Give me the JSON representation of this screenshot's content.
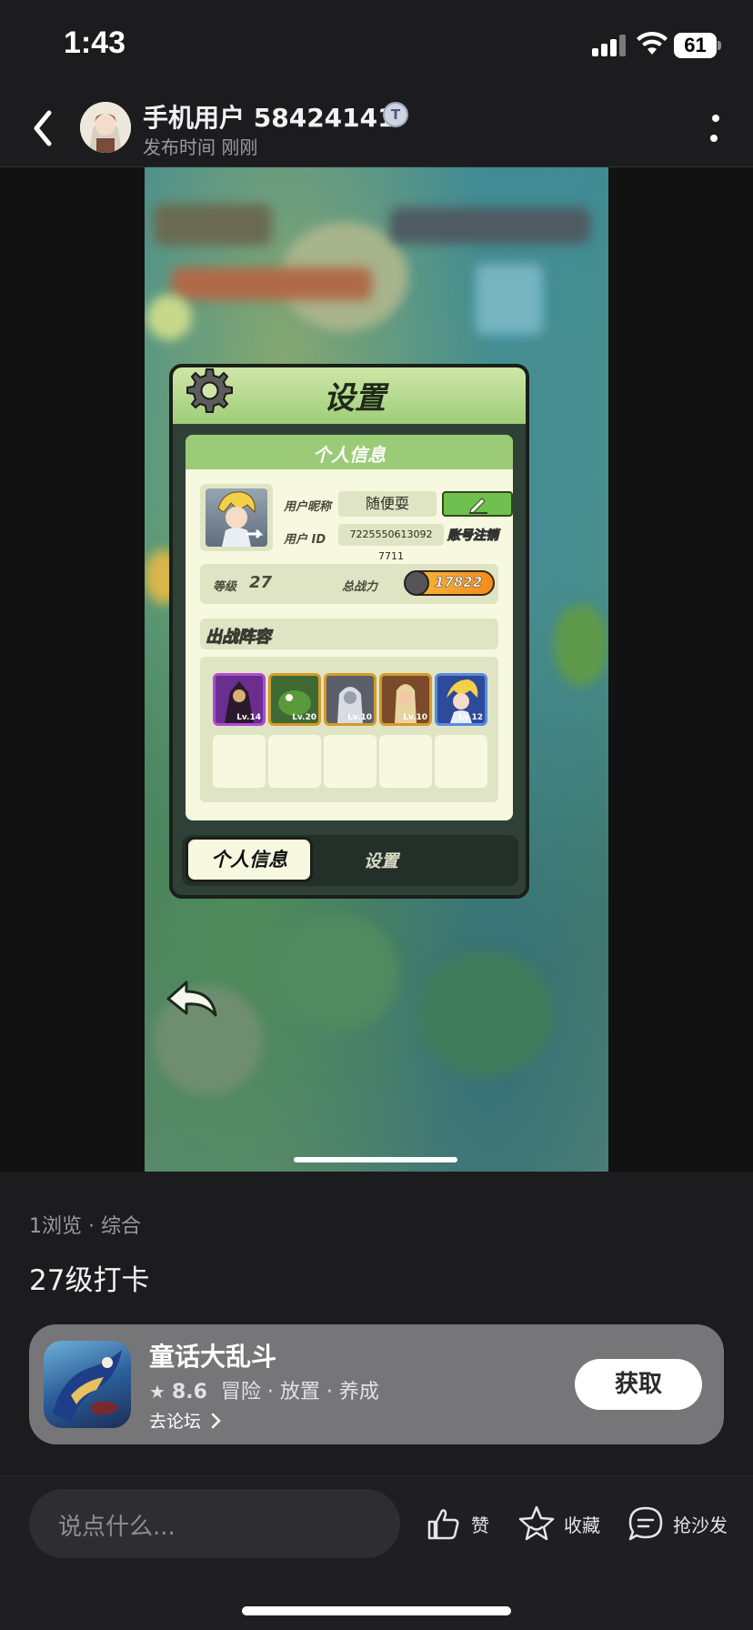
{
  "status_bar": {
    "time": "1:43",
    "battery": "61"
  },
  "header": {
    "user_name": "手机用户 58424141",
    "post_time": "发布时间 刚刚",
    "verified_badge": "T"
  },
  "media": {
    "panel_title": "设置",
    "info_header": "个人信息",
    "nickname_label": "用户昵称",
    "nickname_value": "随便耍",
    "userid_label": "用户 ID",
    "userid_value": "7225550613092​7711",
    "cancel_label": "账号注销",
    "level_label": "等级",
    "level_value": "27",
    "power_label": "总战力",
    "power_value": "17822",
    "lineup_label": "出战阵容",
    "heroes": [
      {
        "level": "Lv.14",
        "color": "#6a2e8e"
      },
      {
        "level": "Lv.20",
        "color": "#3f6a34"
      },
      {
        "level": "Lv.10",
        "color": "#5a5f6a"
      },
      {
        "level": "Lv.10",
        "color": "#7a4a2a"
      },
      {
        "level": "Lv.12",
        "color": "#2e4a9a"
      }
    ],
    "tab_active": "个人信息",
    "tab_inactive": "设置"
  },
  "post": {
    "stats": "1浏览 · 综合",
    "text": "27级打卡"
  },
  "game_card": {
    "name": "童话大乱斗",
    "rating": "8.6",
    "tags": "冒险 · 放置 · 养成",
    "forum_link": "去论坛",
    "get_button": "获取"
  },
  "bottom_bar": {
    "comment_placeholder": "说点什么...",
    "like_label": "赞",
    "collect_label": "收藏",
    "sofa_label": "抢沙发"
  },
  "colors": {
    "background": "#1c1c1e",
    "card": "#767678",
    "panel_green": "#9ccb78"
  }
}
